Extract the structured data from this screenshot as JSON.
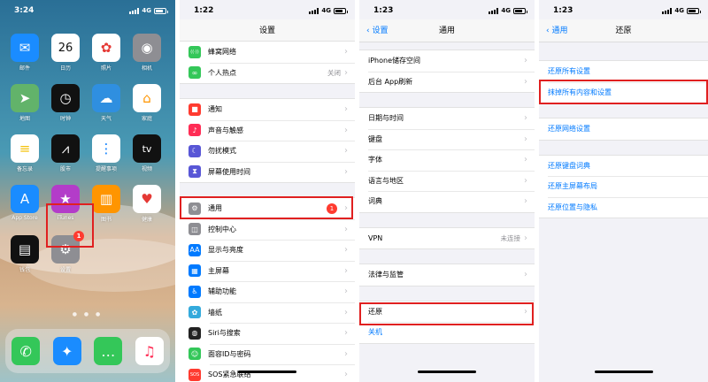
{
  "statusbar": {
    "p1_time": "3:24",
    "p2_time": "1:22",
    "p3_time": "1:23",
    "p4_time": "1:23",
    "network": "4G"
  },
  "home": {
    "apps": [
      {
        "label": "邮件",
        "icon": "mail-icon",
        "color": "#1a8cff",
        "glyph": "✉"
      },
      {
        "label": "日历",
        "icon": "calendar-icon",
        "color": "#ffffff",
        "glyph": "26"
      },
      {
        "label": "照片",
        "icon": "photos-icon",
        "color": "#ffffff",
        "glyph": "✿"
      },
      {
        "label": "相机",
        "icon": "camera-icon",
        "color": "#8e8e93",
        "glyph": "◉"
      },
      {
        "label": "地图",
        "icon": "maps-icon",
        "color": "#62b36a",
        "glyph": "➤"
      },
      {
        "label": "时钟",
        "icon": "clock-icon",
        "color": "#111111",
        "glyph": "◷"
      },
      {
        "label": "天气",
        "icon": "weather-icon",
        "color": "#2f8fe0",
        "glyph": "☁"
      },
      {
        "label": "家庭",
        "icon": "home-icon",
        "color": "#ffffff",
        "glyph": "⌂"
      },
      {
        "label": "备忘录",
        "icon": "notes-icon",
        "color": "#ffffff",
        "glyph": "≡"
      },
      {
        "label": "股市",
        "icon": "stocks-icon",
        "color": "#111111",
        "glyph": "⩘"
      },
      {
        "label": "提醒事项",
        "icon": "reminders-icon",
        "color": "#ffffff",
        "glyph": "⋮"
      },
      {
        "label": "视频",
        "icon": "tv-icon",
        "color": "#111111",
        "glyph": "tv"
      },
      {
        "label": "App Store",
        "icon": "appstore-icon",
        "color": "#1a8cff",
        "glyph": "A"
      },
      {
        "label": "iTunes",
        "icon": "itunes-icon",
        "color": "#b33cc9",
        "glyph": "★"
      },
      {
        "label": "图书",
        "icon": "books-icon",
        "color": "#ff9500",
        "glyph": "▥"
      },
      {
        "label": "健康",
        "icon": "health-icon",
        "color": "#ffffff",
        "glyph": "♥"
      },
      {
        "label": "钱包",
        "icon": "wallet-icon",
        "color": "#111111",
        "glyph": "▤"
      },
      {
        "label": "设置",
        "icon": "settings-icon",
        "color": "#8e8e93",
        "glyph": "⚙",
        "badge": "1"
      }
    ],
    "dock": [
      {
        "icon": "phone-icon",
        "color": "#34c759",
        "glyph": "✆"
      },
      {
        "icon": "safari-icon",
        "color": "#1a8cff",
        "glyph": "✦"
      },
      {
        "icon": "messages-icon",
        "color": "#34c759",
        "glyph": "…"
      },
      {
        "icon": "music-icon",
        "color": "#ffffff",
        "glyph": "♫"
      }
    ]
  },
  "settings": {
    "title": "设置",
    "groups": [
      [
        {
          "label": "蜂窝网络",
          "icon": "cellular-icon",
          "color": "#34c759",
          "glyph": "((·))"
        },
        {
          "label": "个人热点",
          "icon": "hotspot-icon",
          "color": "#34c759",
          "glyph": "∞",
          "value": "关闭"
        }
      ],
      [
        {
          "label": "通知",
          "icon": "notifications-icon",
          "color": "#ff3b30",
          "glyph": "■"
        },
        {
          "label": "声音与触感",
          "icon": "sounds-icon",
          "color": "#ff2d55",
          "glyph": "♪"
        },
        {
          "label": "勿扰模式",
          "icon": "dnd-icon",
          "color": "#5856d6",
          "glyph": "☾"
        },
        {
          "label": "屏幕使用时间",
          "icon": "screentime-icon",
          "color": "#5856d6",
          "glyph": "⧗"
        }
      ],
      [
        {
          "label": "通用",
          "icon": "general-icon",
          "color": "#8e8e93",
          "glyph": "⚙",
          "badge": "1"
        },
        {
          "label": "控制中心",
          "icon": "controlcenter-icon",
          "color": "#8e8e93",
          "glyph": "◫"
        },
        {
          "label": "显示与亮度",
          "icon": "display-icon",
          "color": "#007aff",
          "glyph": "AA"
        },
        {
          "label": "主屏幕",
          "icon": "homescreen-icon",
          "color": "#007aff",
          "glyph": "▦"
        },
        {
          "label": "辅助功能",
          "icon": "accessibility-icon",
          "color": "#007aff",
          "glyph": "♿"
        },
        {
          "label": "墙纸",
          "icon": "wallpaper-icon",
          "color": "#34aadc",
          "glyph": "✿"
        },
        {
          "label": "Siri与搜索",
          "icon": "siri-icon",
          "color": "#222222",
          "glyph": "◍"
        },
        {
          "label": "面容ID与密码",
          "icon": "faceid-icon",
          "color": "#34c759",
          "glyph": "☺"
        },
        {
          "label": "SOS紧急联络",
          "icon": "sos-icon",
          "color": "#ff3b30",
          "glyph": "SOS"
        }
      ]
    ]
  },
  "general": {
    "back": "设置",
    "title": "通用",
    "groups": [
      [
        {
          "label": "iPhone储存空间"
        },
        {
          "label": "后台 App刷新"
        }
      ],
      [
        {
          "label": "日期与时间"
        },
        {
          "label": "键盘"
        },
        {
          "label": "字体"
        },
        {
          "label": "语言与地区"
        },
        {
          "label": "词典"
        }
      ],
      [
        {
          "label": "VPN",
          "value": "未连接"
        }
      ],
      [
        {
          "label": "法律与监管"
        }
      ],
      [
        {
          "label": "还原"
        },
        {
          "label": "关机",
          "blue": true
        }
      ]
    ]
  },
  "reset": {
    "back": "通用",
    "title": "还原",
    "groups": [
      [
        {
          "label": "还原所有设置"
        },
        {
          "label": "抹掉所有内容和设置"
        }
      ],
      [
        {
          "label": "还原网络设置"
        }
      ],
      [
        {
          "label": "还原键盘词典"
        },
        {
          "label": "还原主屏幕布局"
        },
        {
          "label": "还原位置与隐私"
        }
      ]
    ]
  }
}
